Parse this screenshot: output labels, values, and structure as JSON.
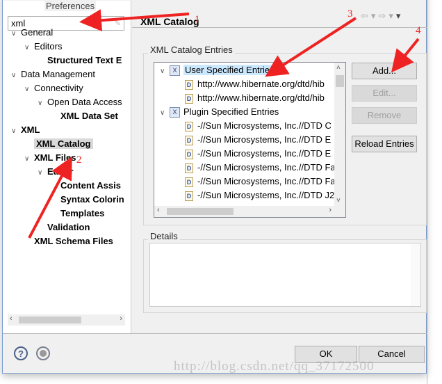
{
  "window": {
    "title": "Preferences"
  },
  "search": {
    "value": "xml"
  },
  "nav_tree": [
    {
      "label": "General",
      "depth": 0,
      "chevron": true,
      "bold": false
    },
    {
      "label": "Editors",
      "depth": 1,
      "chevron": true,
      "bold": false
    },
    {
      "label": "Structured Text E",
      "depth": 2,
      "chevron": false,
      "bold": true
    },
    {
      "label": "Data Management",
      "depth": 0,
      "chevron": true,
      "bold": false
    },
    {
      "label": "Connectivity",
      "depth": 1,
      "chevron": true,
      "bold": false
    },
    {
      "label": "Open Data Access",
      "depth": 2,
      "chevron": true,
      "bold": false
    },
    {
      "label": "XML Data Set",
      "depth": 3,
      "chevron": false,
      "bold": true
    },
    {
      "label": "XML",
      "depth": 0,
      "chevron": true,
      "bold": true
    },
    {
      "label": "XML Catalog",
      "depth": 1,
      "chevron": false,
      "bold": true,
      "selected": true
    },
    {
      "label": "XML Files",
      "depth": 1,
      "chevron": true,
      "bold": true
    },
    {
      "label": "Editor",
      "depth": 2,
      "chevron": true,
      "bold": true
    },
    {
      "label": "Content Assis",
      "depth": 3,
      "chevron": false,
      "bold": true
    },
    {
      "label": "Syntax Colorin",
      "depth": 3,
      "chevron": false,
      "bold": true
    },
    {
      "label": "Templates",
      "depth": 3,
      "chevron": false,
      "bold": true
    },
    {
      "label": "Validation",
      "depth": 2,
      "chevron": false,
      "bold": true
    },
    {
      "label": "XML Schema Files",
      "depth": 1,
      "chevron": false,
      "bold": true
    }
  ],
  "page": {
    "title": "XML Catalog",
    "entries_group": "XML Catalog Entries",
    "details_group": "Details"
  },
  "catalog_tree": [
    {
      "label": "User Specified Entries",
      "type": "group",
      "selected": true
    },
    {
      "label": "http://www.hibernate.org/dtd/hib",
      "type": "entry"
    },
    {
      "label": "http://www.hibernate.org/dtd/hib",
      "type": "entry"
    },
    {
      "label": "Plugin Specified Entries",
      "type": "group"
    },
    {
      "label": "-//Sun Microsystems, Inc.//DTD C",
      "type": "entry"
    },
    {
      "label": "-//Sun Microsystems, Inc.//DTD E",
      "type": "entry"
    },
    {
      "label": "-//Sun Microsystems, Inc.//DTD E",
      "type": "entry"
    },
    {
      "label": "-//Sun Microsystems, Inc.//DTD Fa",
      "type": "entry"
    },
    {
      "label": "-//Sun Microsystems, Inc.//DTD Fa",
      "type": "entry"
    },
    {
      "label": "-//Sun Microsystems, Inc.//DTD J2",
      "type": "entry"
    }
  ],
  "buttons": {
    "add": "Add...",
    "edit": "Edit...",
    "remove": "Remove",
    "reload": "Reload Entries",
    "ok": "OK",
    "cancel": "Cancel"
  },
  "annotations": [
    "1",
    "2",
    "3",
    "4"
  ],
  "watermark": "http://blog.csdn.net/qq_37172500",
  "colors": {
    "annotation": "#ee2222",
    "selection": "#cce8ff"
  }
}
